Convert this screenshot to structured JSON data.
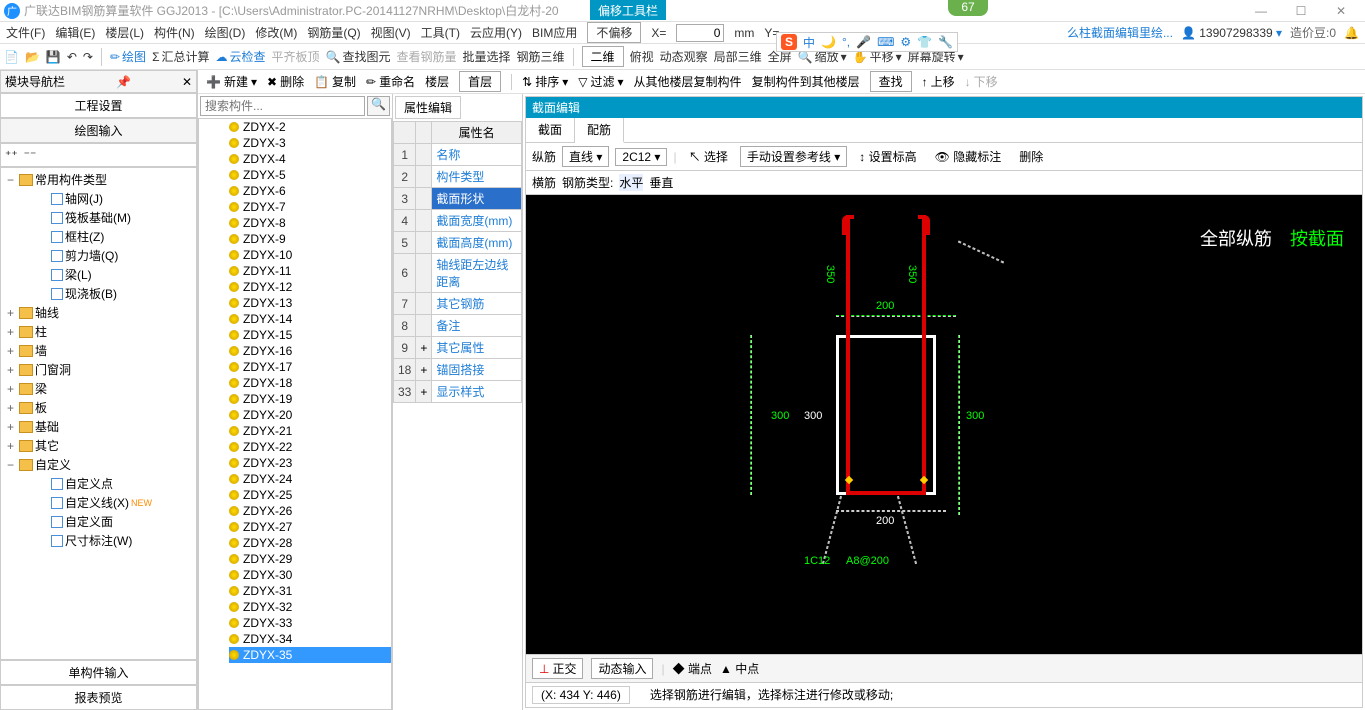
{
  "title": {
    "app": "广联达BIM钢筋算量软件 GGJ2013 - [C:\\Users\\Administrator.PC-20141127NRHM\\Desktop\\白龙村-20",
    "float": "偏移工具栏",
    "badge": "67"
  },
  "menu": [
    "文件(F)",
    "编辑(E)",
    "楼层(L)",
    "构件(N)",
    "绘图(D)",
    "修改(M)",
    "钢筋量(Q)",
    "视图(V)",
    "工具(T)",
    "云应用(Y)",
    "BIM应用"
  ],
  "menu_right": {
    "link": "么柱截面编辑里绘...",
    "user": "13907298339",
    "bean": "造价豆:0"
  },
  "offset_bar": {
    "mode": "不偏移",
    "xlabel": "X=",
    "xval": "0",
    "unit": "mm",
    "ylabel": "Y="
  },
  "ime": {
    "logo": "S",
    "lang": "中"
  },
  "toolbar1": [
    "绘图",
    "汇总计算",
    "云检查",
    "平齐板顶",
    "查找图元",
    "查看钢筋量",
    "批量选择",
    "钢筋三维",
    "二维",
    "俯视",
    "动态观察",
    "局部三维",
    "全屏",
    "缩放",
    "平移",
    "屏幕旋转"
  ],
  "toolbar2": {
    "new": "新建",
    "del": "删除",
    "copy": "复制",
    "rename": "重命名",
    "floor": "楼层",
    "floor_val": "首层",
    "sort": "排序",
    "filter": "过滤",
    "from_other": "从其他楼层复制构件",
    "to_other": "复制构件到其他楼层",
    "find": "查找",
    "up": "上移",
    "down": "下移"
  },
  "left": {
    "header": "模块导航栏",
    "eng_set": "工程设置",
    "draw_input": "绘图输入",
    "single_input": "单构件输入",
    "report": "报表预览",
    "tree": [
      {
        "exp": "−",
        "label": "常用构件类型",
        "folder": true,
        "indent": 0,
        "children": [
          {
            "label": "轴网(J)",
            "indent": 1
          },
          {
            "label": "筏板基础(M)",
            "indent": 1
          },
          {
            "label": "框柱(Z)",
            "indent": 1
          },
          {
            "label": "剪力墙(Q)",
            "indent": 1
          },
          {
            "label": "梁(L)",
            "indent": 1
          },
          {
            "label": "现浇板(B)",
            "indent": 1
          }
        ]
      },
      {
        "exp": "+",
        "label": "轴线",
        "folder": true,
        "indent": 0
      },
      {
        "exp": "+",
        "label": "柱",
        "folder": true,
        "indent": 0
      },
      {
        "exp": "+",
        "label": "墙",
        "folder": true,
        "indent": 0
      },
      {
        "exp": "+",
        "label": "门窗洞",
        "folder": true,
        "indent": 0
      },
      {
        "exp": "+",
        "label": "梁",
        "folder": true,
        "indent": 0
      },
      {
        "exp": "+",
        "label": "板",
        "folder": true,
        "indent": 0
      },
      {
        "exp": "+",
        "label": "基础",
        "folder": true,
        "indent": 0
      },
      {
        "exp": "+",
        "label": "其它",
        "folder": true,
        "indent": 0
      },
      {
        "exp": "−",
        "label": "自定义",
        "folder": true,
        "indent": 0,
        "children": [
          {
            "label": "自定义点",
            "indent": 1
          },
          {
            "label": "自定义线(X)",
            "indent": 1,
            "sel": true,
            "new": true
          },
          {
            "label": "自定义面",
            "indent": 1
          },
          {
            "label": "尺寸标注(W)",
            "indent": 1
          }
        ]
      }
    ]
  },
  "mid": {
    "search_ph": "搜索构件...",
    "items": [
      "ZDYX-2",
      "ZDYX-3",
      "ZDYX-4",
      "ZDYX-5",
      "ZDYX-6",
      "ZDYX-7",
      "ZDYX-8",
      "ZDYX-9",
      "ZDYX-10",
      "ZDYX-11",
      "ZDYX-12",
      "ZDYX-13",
      "ZDYX-14",
      "ZDYX-15",
      "ZDYX-16",
      "ZDYX-17",
      "ZDYX-18",
      "ZDYX-19",
      "ZDYX-20",
      "ZDYX-21",
      "ZDYX-22",
      "ZDYX-23",
      "ZDYX-24",
      "ZDYX-25",
      "ZDYX-26",
      "ZDYX-27",
      "ZDYX-28",
      "ZDYX-29",
      "ZDYX-30",
      "ZDYX-31",
      "ZDYX-32",
      "ZDYX-33",
      "ZDYX-34",
      "ZDYX-35"
    ],
    "selected": "ZDYX-35"
  },
  "prop": {
    "tab": "属性编辑",
    "header": "属性名",
    "rows": [
      {
        "n": "1",
        "name": "名称"
      },
      {
        "n": "2",
        "name": "构件类型"
      },
      {
        "n": "3",
        "name": "截面形状",
        "sel": true
      },
      {
        "n": "4",
        "name": "截面宽度(mm)"
      },
      {
        "n": "5",
        "name": "截面高度(mm)"
      },
      {
        "n": "6",
        "name": "轴线距左边线距离"
      },
      {
        "n": "7",
        "name": "其它钢筋"
      },
      {
        "n": "8",
        "name": "备注"
      },
      {
        "n": "9",
        "name": "其它属性",
        "plus": true
      },
      {
        "n": "18",
        "name": "锚固搭接",
        "plus": true
      },
      {
        "n": "33",
        "name": "显示样式",
        "plus": true
      }
    ]
  },
  "section": {
    "title": "截面编辑",
    "tabs": [
      "截面",
      "配筋"
    ],
    "active_tab": "配筋",
    "row1": {
      "l1": "纵筋",
      "line": "直线",
      "spec": "2C12",
      "select": "选择",
      "ref": "手动设置参考线",
      "elev": "设置标高",
      "hide": "隐藏标注",
      "del": "删除"
    },
    "row2": {
      "l1": "横筋",
      "l2": "钢筋类型:",
      "horiz": "水平",
      "vert": "垂直"
    },
    "canvas": {
      "big_label1": "全部纵筋",
      "big_label2": "按截面",
      "d200_top": "200",
      "d200_bot": "200",
      "d300l": "300",
      "d300r": "300",
      "d300ll": "300",
      "d350l": "350",
      "d350r": "350",
      "note_l": "1C12",
      "note_r": "A8@200"
    },
    "bottom": {
      "ortho": "正交",
      "dyn": "动态输入",
      "end": "端点",
      "mid": "中点"
    },
    "status": {
      "coord": "(X: 434 Y: 446)",
      "hint": "选择钢筋进行编辑，选择标注进行修改或移动;"
    }
  }
}
